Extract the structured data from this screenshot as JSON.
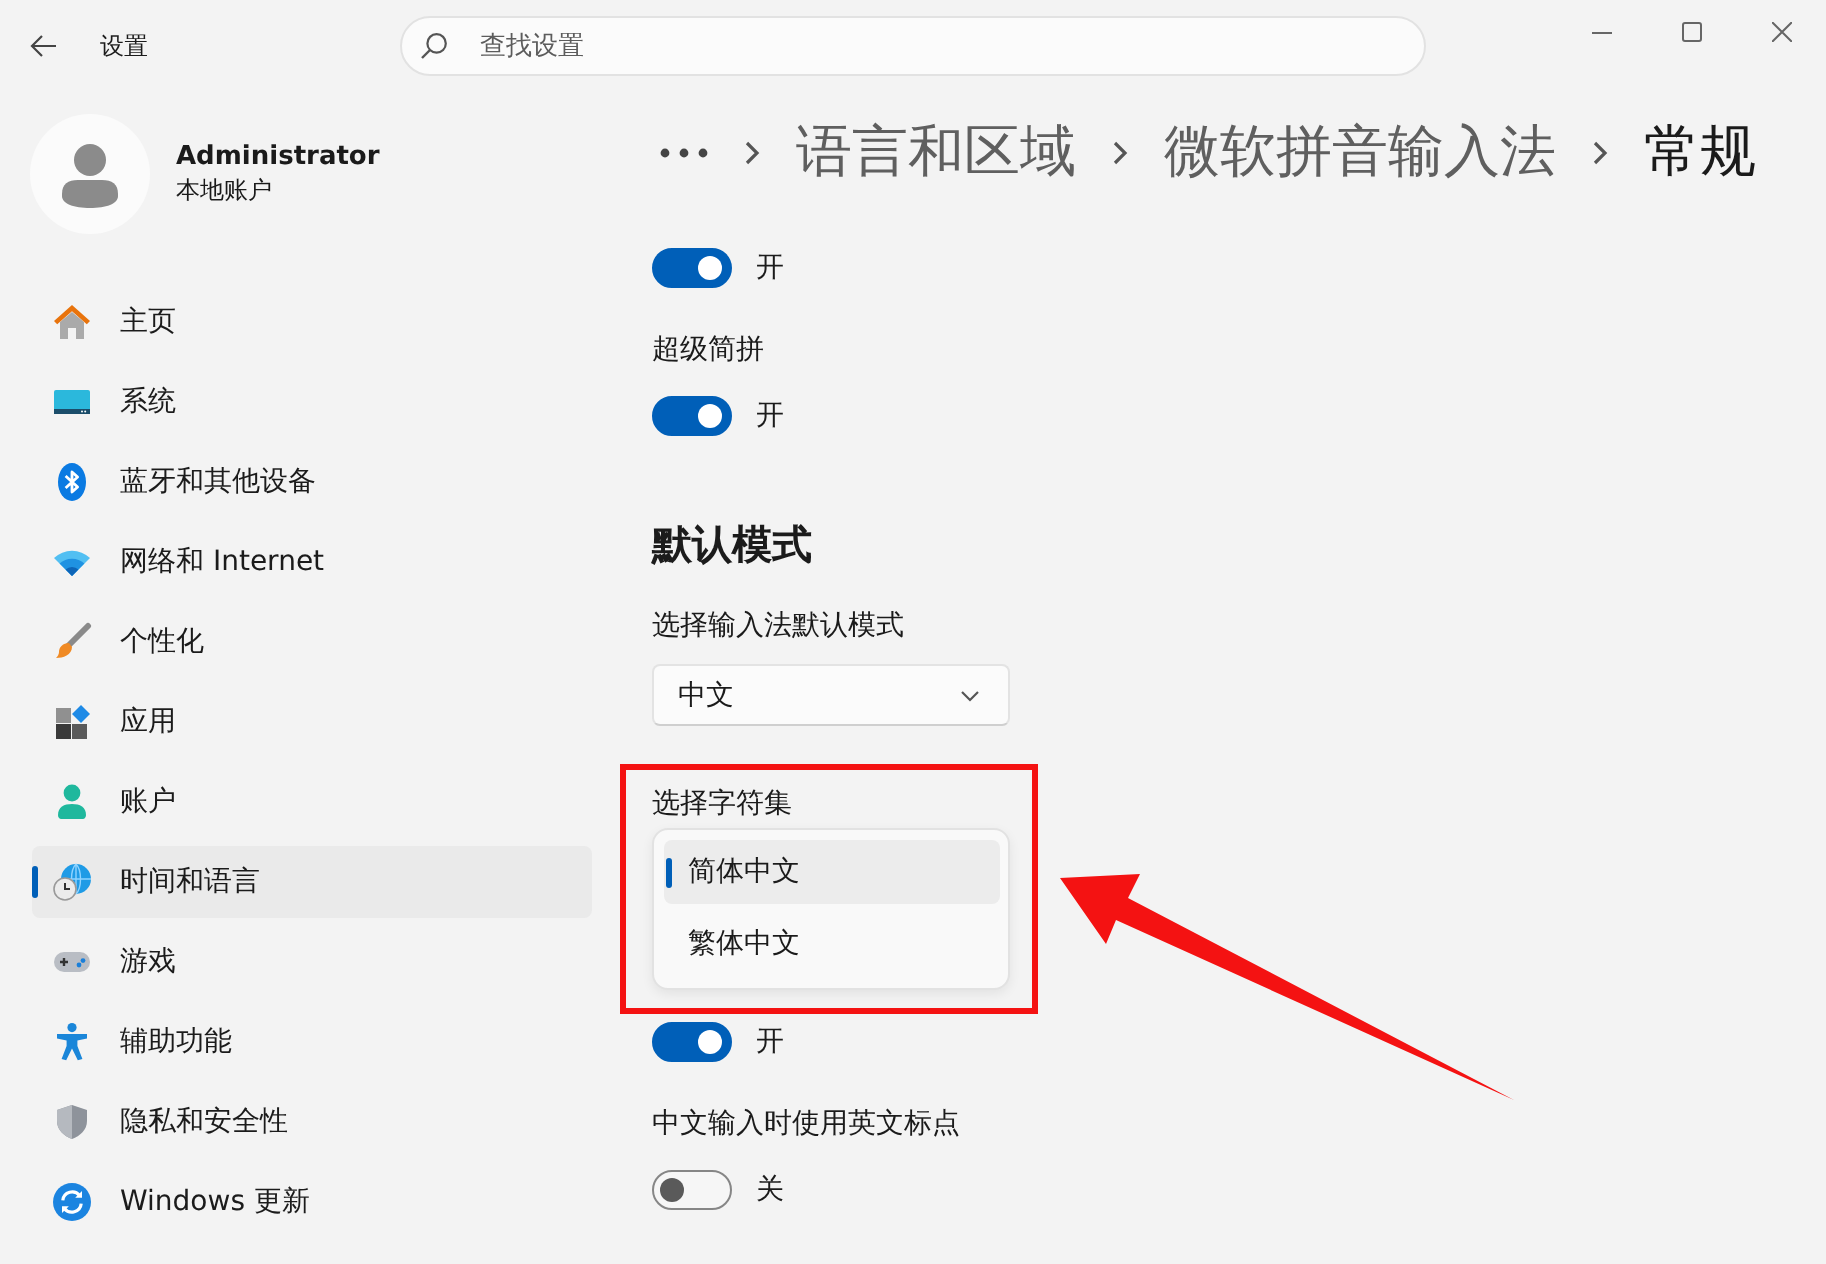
{
  "window": {
    "title": "设置"
  },
  "search": {
    "placeholder": "查找设置"
  },
  "account": {
    "name": "Administrator",
    "type": "本地账户"
  },
  "sidebar": {
    "items": [
      {
        "label": "主页",
        "selected": false
      },
      {
        "label": "系统",
        "selected": false
      },
      {
        "label": "蓝牙和其他设备",
        "selected": false
      },
      {
        "label": "网络和 Internet",
        "selected": false
      },
      {
        "label": "个性化",
        "selected": false
      },
      {
        "label": "应用",
        "selected": false
      },
      {
        "label": "账户",
        "selected": false
      },
      {
        "label": "时间和语言",
        "selected": true
      },
      {
        "label": "游戏",
        "selected": false
      },
      {
        "label": "辅助功能",
        "selected": false
      },
      {
        "label": "隐私和安全性",
        "selected": false
      },
      {
        "label": "Windows 更新",
        "selected": false
      }
    ]
  },
  "breadcrumb": [
    {
      "label": "语言和区域",
      "current": false
    },
    {
      "label": "微软拼音输入法",
      "current": false
    },
    {
      "label": "常规",
      "current": true
    }
  ],
  "settings": [
    {
      "kind": "toggle",
      "on": true,
      "state_label": "开"
    },
    {
      "kind": "toggle",
      "label": "超级简拼",
      "on": true,
      "state_label": "开"
    },
    {
      "kind": "heading",
      "label": "默认模式"
    },
    {
      "kind": "dropdown",
      "label": "选择输入法默认模式",
      "value": "中文"
    },
    {
      "kind": "dropdown_open",
      "label": "选择字符集",
      "options": [
        {
          "label": "简体中文",
          "selected": true
        },
        {
          "label": "繁体中文",
          "selected": false
        }
      ]
    },
    {
      "kind": "toggle",
      "on": true,
      "state_label": "开"
    },
    {
      "kind": "toggle",
      "label": "中文输入时使用英文标点",
      "on": false,
      "state_label": "关"
    }
  ],
  "annotation": {
    "frame": true,
    "arrow": true
  }
}
